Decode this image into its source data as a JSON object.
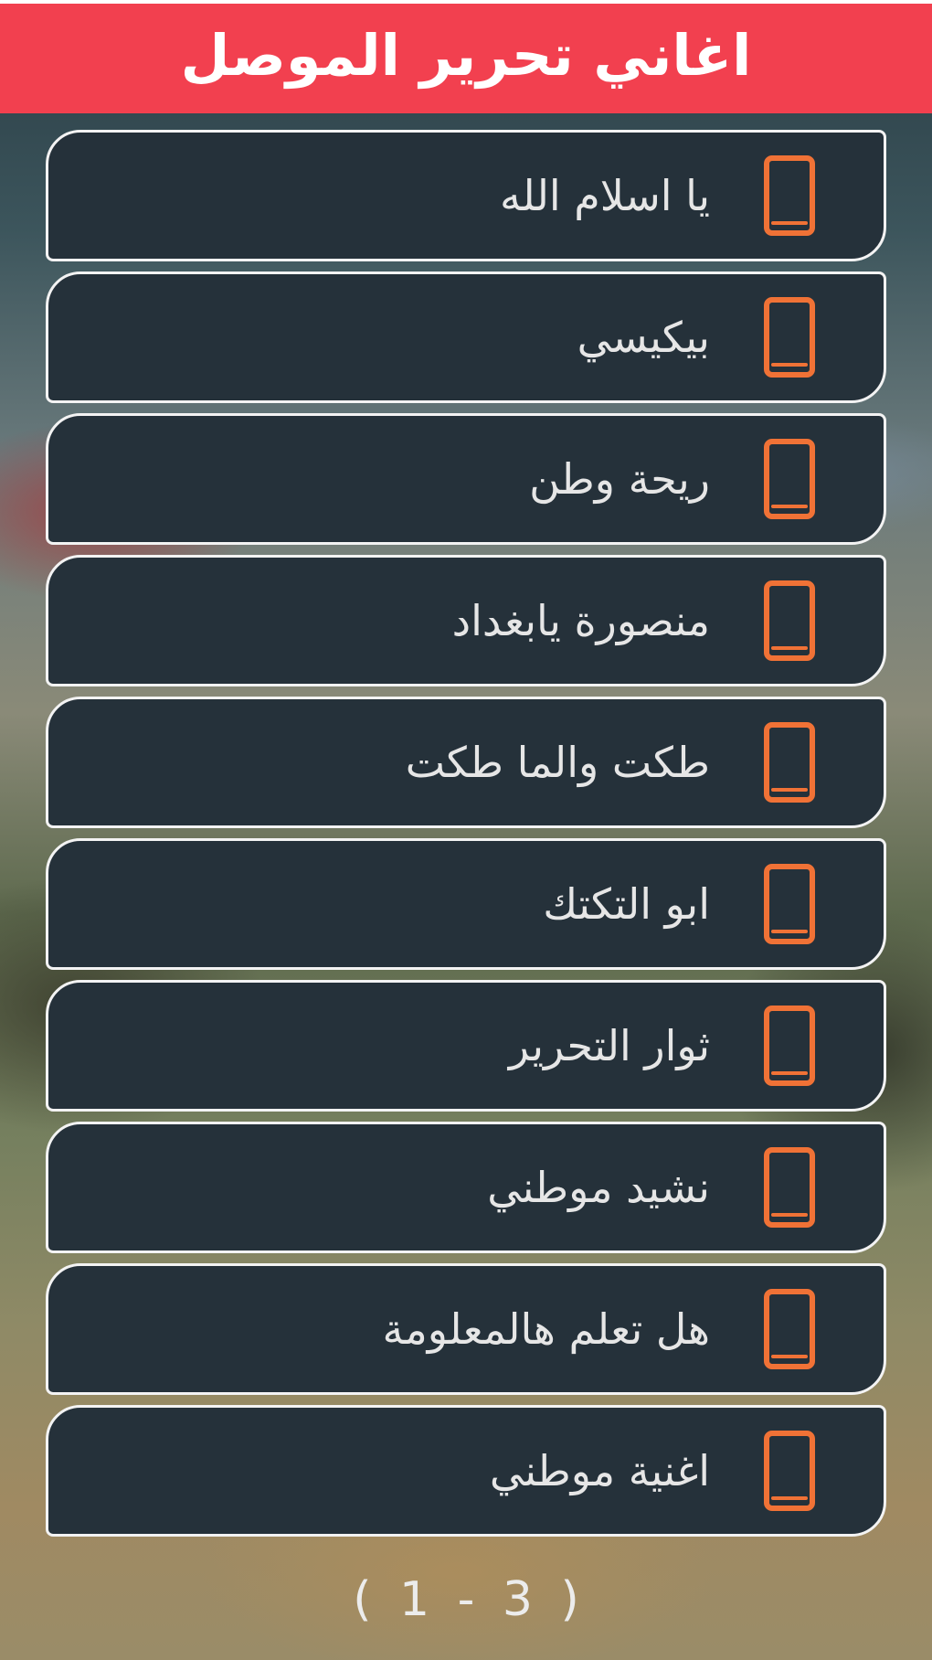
{
  "header": {
    "title": "اغاني تحرير الموصل",
    "color": "#f2404f"
  },
  "songs": {
    "icon": "smartphone-icon",
    "icon_color": "#f07236",
    "items": [
      {
        "label": "يا اسلام الله"
      },
      {
        "label": "بيكيسي"
      },
      {
        "label": "ريحة وطن"
      },
      {
        "label": "منصورة يابغداد"
      },
      {
        "label": "طكت والما طكت"
      },
      {
        "label": "ابو التكتك"
      },
      {
        "label": "ثوار التحرير"
      },
      {
        "label": "نشيد موطني"
      },
      {
        "label": "هل تعلم هالمعلومة"
      },
      {
        "label": "اغنية موطني"
      }
    ]
  },
  "pagination": {
    "text": "( 1 - 3 )"
  }
}
